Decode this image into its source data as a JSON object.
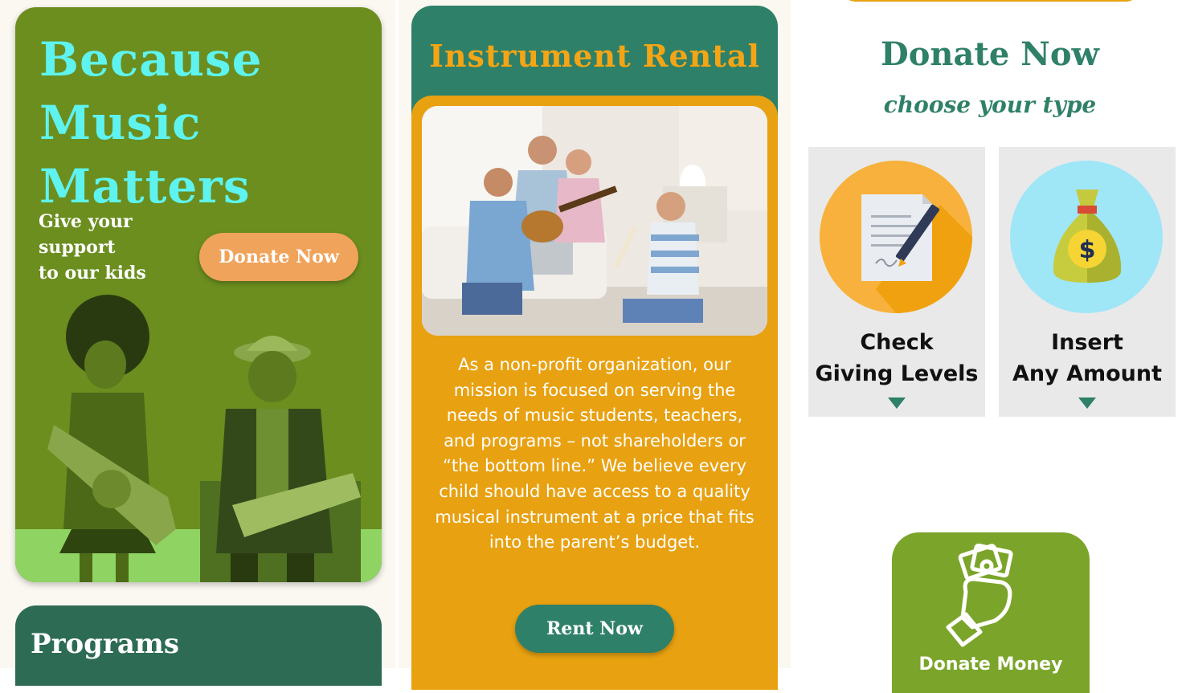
{
  "hero": {
    "title_line1": "Because",
    "title_line2": "Music",
    "title_line3": "Matters",
    "sub_line1": "Give your",
    "sub_line2": "support",
    "sub_line3": "to our kids",
    "donate_button": "Donate Now"
  },
  "programs": {
    "title": "Programs"
  },
  "rental": {
    "title": "Instrument Rental",
    "description": "As a non-profit organization, our mission is focused on serving the needs of music students, teachers, and programs – not shareholders or “the bottom line.” We believe every child should have access to a quality musical instrument at a price that fits into the parent’s budget.",
    "rent_button": "Rent Now"
  },
  "donate": {
    "title": "Donate Now",
    "subtitle": "choose your type",
    "types": [
      {
        "line1": "Check",
        "line2": "Giving Levels",
        "icon": "document-pen-icon"
      },
      {
        "line1": "Insert",
        "line2": "Any Amount",
        "icon": "money-bag-icon"
      }
    ],
    "money_card_label": "Donate Money",
    "money_card_icon": "hand-cash-icon"
  },
  "colors": {
    "hero_green": "#6b8e1f",
    "title_cyan": "#5ef3ef",
    "button_orange": "#f0a35a",
    "teal": "#2f8068",
    "dark_teal": "#2d6b55",
    "amber": "#e8a111",
    "olive": "#7ba52a"
  }
}
